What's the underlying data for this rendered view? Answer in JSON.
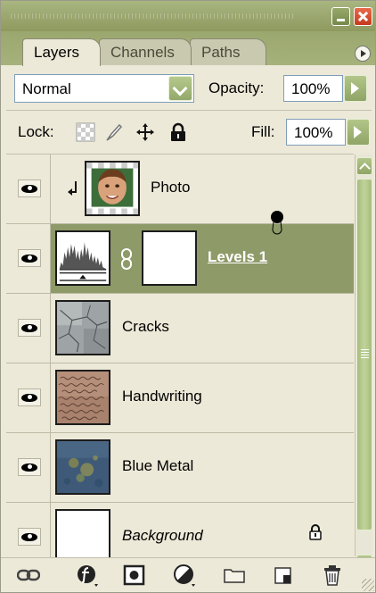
{
  "window": {
    "colors": {
      "panel": "#ece9d8",
      "title_bar": "#8e9a5f",
      "accent_button": "#93a869",
      "selected_row": "#8e9a68",
      "close_button": "#c5391c"
    }
  },
  "tabs": [
    {
      "label": "Layers",
      "active": true
    },
    {
      "label": "Channels",
      "active": false
    },
    {
      "label": "Paths",
      "active": false
    }
  ],
  "blend": {
    "mode": "Normal"
  },
  "opacity": {
    "label": "Opacity:",
    "value": "100%"
  },
  "lock": {
    "label": "Lock:",
    "icons": [
      "lock-transparent-icon",
      "lock-pixels-icon",
      "lock-position-icon",
      "lock-all-icon"
    ]
  },
  "fill": {
    "label": "Fill:",
    "value": "100%"
  },
  "layers": [
    {
      "name": "Photo",
      "visible": true,
      "clipped": true,
      "selected": false,
      "thumbnail": "photo-child"
    },
    {
      "name": "Levels 1",
      "visible": true,
      "selected": true,
      "thumbnail": "levels-histogram",
      "has_mask": true,
      "linked": true
    },
    {
      "name": "Cracks",
      "visible": true,
      "selected": false,
      "thumbnail": "cracks-texture"
    },
    {
      "name": "Handwriting",
      "visible": true,
      "selected": false,
      "thumbnail": "handwriting-texture"
    },
    {
      "name": "Blue Metal",
      "visible": true,
      "selected": false,
      "thumbnail": "blue-metal-texture"
    },
    {
      "name": "Background",
      "visible": true,
      "selected": false,
      "locked": true,
      "italic": true,
      "thumbnail": "white"
    }
  ],
  "toolbar": {
    "icons": [
      "link-layers-icon",
      "layer-style-icon",
      "add-mask-icon",
      "new-adjustment-icon",
      "new-group-icon",
      "new-layer-icon",
      "delete-layer-icon"
    ]
  }
}
